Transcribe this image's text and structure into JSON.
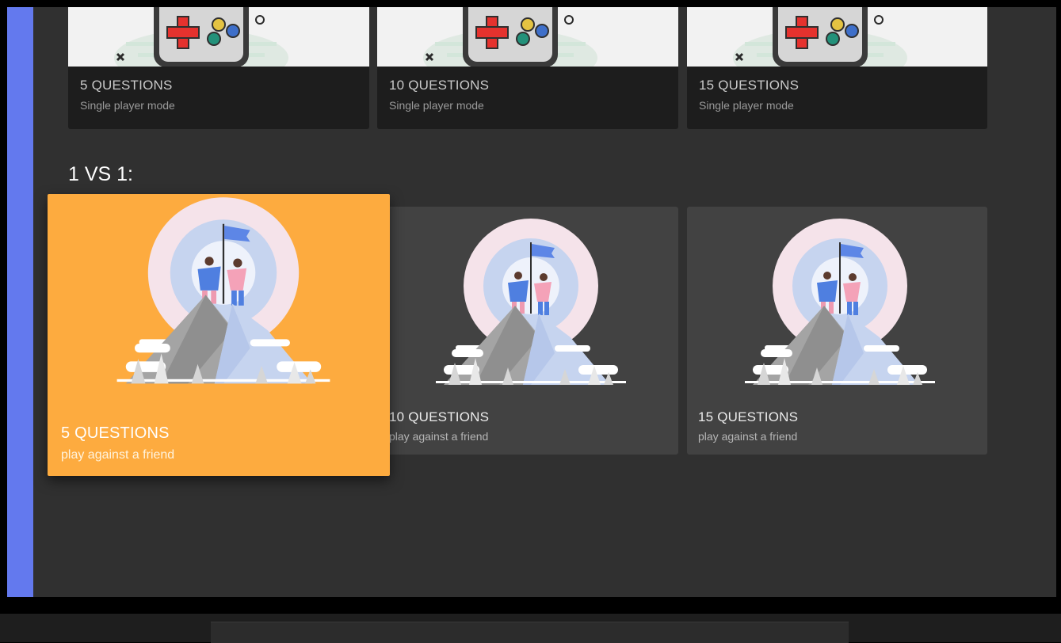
{
  "single_player_cards": [
    {
      "title": "5 QUESTIONS",
      "subtitle": "Single player mode",
      "icon": "gamepad-illustration"
    },
    {
      "title": "10 QUESTIONS",
      "subtitle": "Single player mode",
      "icon": "gamepad-illustration"
    },
    {
      "title": "15 QUESTIONS",
      "subtitle": "Single player mode",
      "icon": "gamepad-illustration"
    }
  ],
  "versus": {
    "heading": "1 VS 1:",
    "cards": [
      {
        "title": "5 QUESTIONS",
        "subtitle": "play against a friend",
        "icon": "mountain-summit-illustration",
        "selected": true
      },
      {
        "title": "10 QUESTIONS",
        "subtitle": "play against a friend",
        "icon": "mountain-summit-illustration"
      },
      {
        "title": "15 QUESTIONS",
        "subtitle": "play against a friend",
        "icon": "mountain-summit-illustration"
      }
    ]
  },
  "colors": {
    "sidebar_accent": "#6379ee",
    "selected_card": "#fdab3f",
    "background": "#303030",
    "card": "#424242"
  }
}
